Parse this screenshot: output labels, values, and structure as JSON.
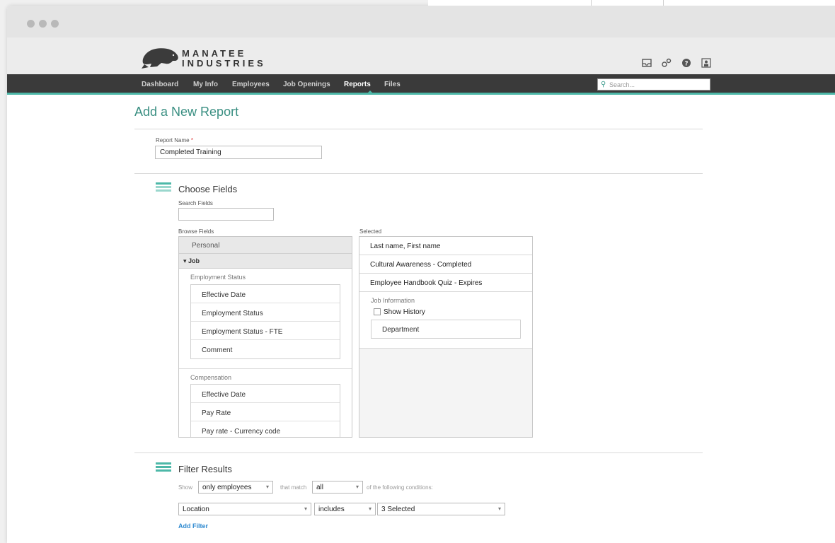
{
  "window": {
    "dots": [
      "window-dot",
      "window-dot",
      "window-dot"
    ]
  },
  "brand": {
    "line1": "MANATEE",
    "line2": "INDUSTRIES"
  },
  "header_icons": [
    "inbox-icon",
    "people-icon",
    "help-icon",
    "user-icon"
  ],
  "nav": {
    "items": [
      "Dashboard",
      "My Info",
      "Employees",
      "Job Openings",
      "Reports",
      "Files"
    ],
    "active": "Reports",
    "search_placeholder": "Search..."
  },
  "page": {
    "title": "Add a New Report"
  },
  "report_name": {
    "label": "Report Name",
    "required_mark": "*",
    "value": "Completed Training"
  },
  "choose_fields": {
    "title": "Choose Fields",
    "search_label": "Search Fields",
    "search_value": "",
    "browse_label": "Browse Fields",
    "selected_label": "Selected",
    "groups": {
      "personal": "Personal",
      "job": "▾ Job"
    },
    "employment_status": {
      "label": "Employment Status",
      "fields": [
        "Effective Date",
        "Employment Status",
        "Employment Status - FTE",
        "Comment"
      ]
    },
    "compensation": {
      "label": "Compensation",
      "fields": [
        "Effective Date",
        "Pay Rate",
        "Pay rate - Currency code"
      ]
    },
    "selected": {
      "rows": [
        "Last name, First name",
        "Cultural Awareness - Completed",
        "Employee Handbook Quiz - Expires"
      ],
      "job_info_label": "Job Information",
      "show_history_label": "Show History",
      "department": "Department"
    }
  },
  "filter": {
    "title": "Filter Results",
    "show_label": "Show",
    "show_value": "only employees",
    "match_label": "that match",
    "match_value": "all",
    "conditions_label": "of the following conditions:",
    "field_value": "Location",
    "op_value": "includes",
    "values_value": "3 Selected",
    "add_filter": "Add Filter"
  },
  "colors": {
    "accent": "#4db8a8",
    "nav_bg": "#3a3a3a",
    "link": "#2f8ad0"
  }
}
